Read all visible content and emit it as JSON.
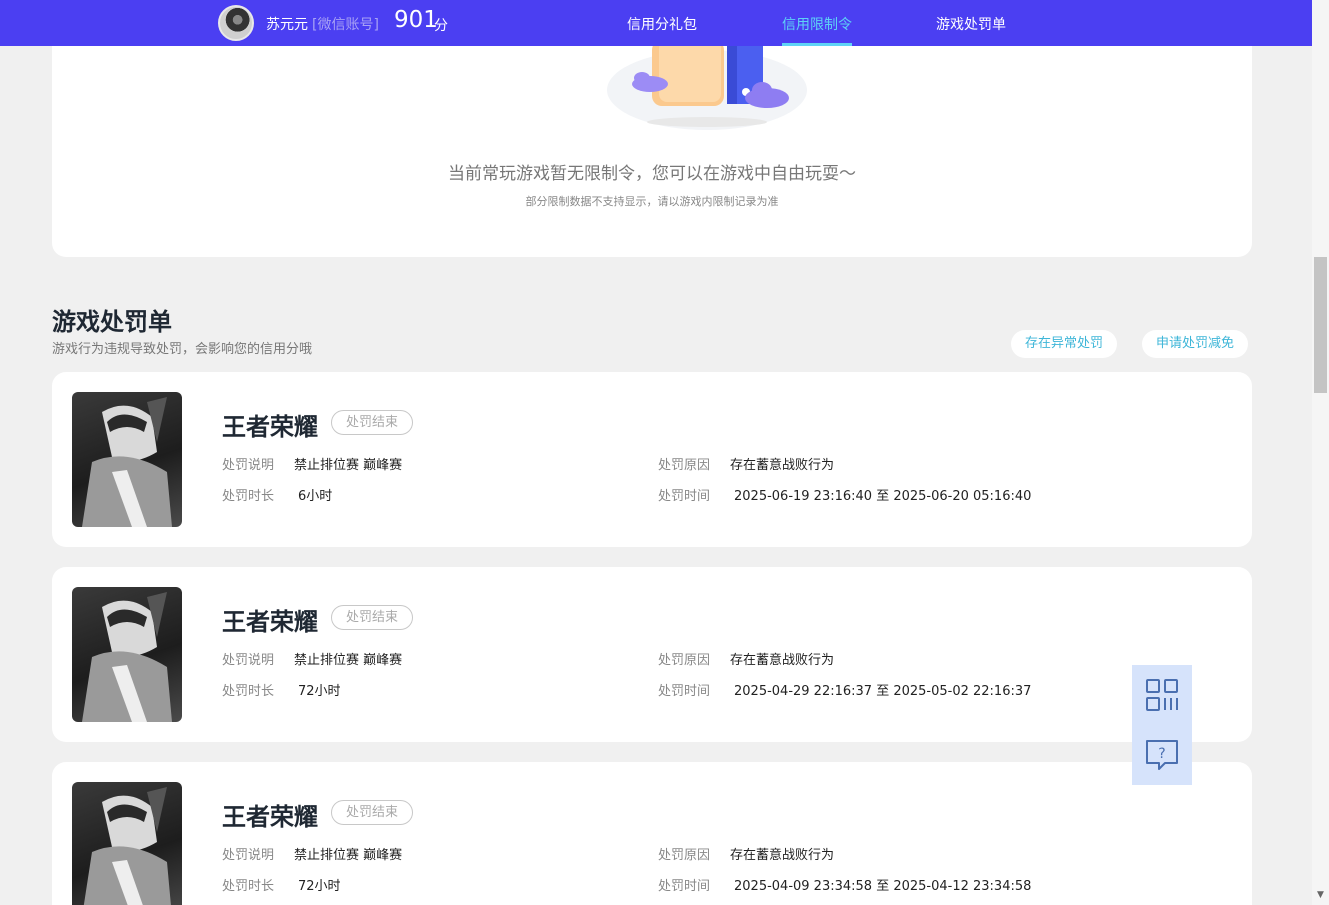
{
  "header": {
    "user_name": "苏元元",
    "account_type": "[微信账号]",
    "score": "901",
    "score_unit": "分",
    "nav": [
      {
        "label": "信用分礼包",
        "active": false
      },
      {
        "label": "信用限制令",
        "active": true
      },
      {
        "label": "游戏处罚单",
        "active": false
      }
    ]
  },
  "restriction": {
    "empty_title": "当前常玩游戏暂无限制令，您可以在游戏中自由玩耍～",
    "empty_subtitle": "部分限制数据不支持显示，请以游戏内限制记录为准"
  },
  "penalty_section": {
    "title": "游戏处罚单",
    "subtitle": "游戏行为违规导致处罚，会影响您的信用分哦",
    "actions": [
      "存在异常处罚",
      "申请处罚减免"
    ]
  },
  "penalties": [
    {
      "game": "王者荣耀",
      "status": "处罚结束",
      "desc_label": "处罚说明",
      "desc": "禁止排位赛 巅峰赛",
      "duration_label": "处罚时长",
      "duration": "6小时",
      "reason_label": "处罚原因",
      "reason": "存在蓄意战败行为",
      "time_label": "处罚时间",
      "time": "2025-06-19 23:16:40 至 2025-06-20 05:16:40"
    },
    {
      "game": "王者荣耀",
      "status": "处罚结束",
      "desc_label": "处罚说明",
      "desc": "禁止排位赛 巅峰赛",
      "duration_label": "处罚时长",
      "duration": "72小时",
      "reason_label": "处罚原因",
      "reason": "存在蓄意战败行为",
      "time_label": "处罚时间",
      "time": "2025-04-29 22:16:37 至 2025-05-02 22:16:37"
    },
    {
      "game": "王者荣耀",
      "status": "处罚结束",
      "desc_label": "处罚说明",
      "desc": "禁止排位赛 巅峰赛",
      "duration_label": "处罚时长",
      "duration": "72小时",
      "reason_label": "处罚原因",
      "reason": "存在蓄意战败行为",
      "time_label": "处罚时间",
      "time": "2025-04-09 23:34:58 至 2025-04-12 23:34:58"
    }
  ],
  "side_tools": [
    {
      "icon": "qr-code-icon"
    },
    {
      "icon": "help-chat-icon"
    }
  ],
  "colors": {
    "header_bg": "#4b3ff2",
    "active_nav": "#5ed3f6",
    "pill_text": "#3eb6d8",
    "side_btn_bg": "#d6e3fb"
  }
}
